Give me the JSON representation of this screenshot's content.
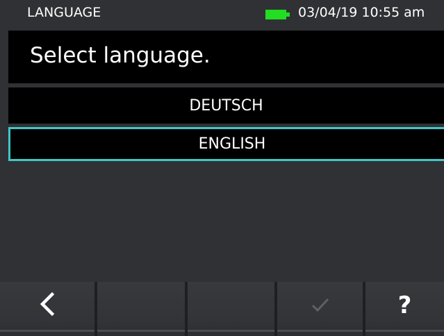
{
  "status_bar": {
    "title": "LANGUAGE",
    "datetime": "03/04/19 10:55 am",
    "battery_icon": "battery-full-icon",
    "battery_color": "#22dd22"
  },
  "header": {
    "prompt": "Select language."
  },
  "languages": {
    "items": [
      {
        "label": "DEUTSCH",
        "selected": false
      },
      {
        "label": "ENGLISH",
        "selected": true
      }
    ],
    "selection_color": "#3fc8c8"
  },
  "softkeys": {
    "back": {
      "icon": "chevron-left-icon",
      "glyph": "<"
    },
    "blank1": {
      "label": ""
    },
    "blank2": {
      "label": ""
    },
    "confirm": {
      "icon": "checkmark-icon",
      "enabled": false
    },
    "help": {
      "icon": "help-icon",
      "glyph": "?"
    }
  }
}
